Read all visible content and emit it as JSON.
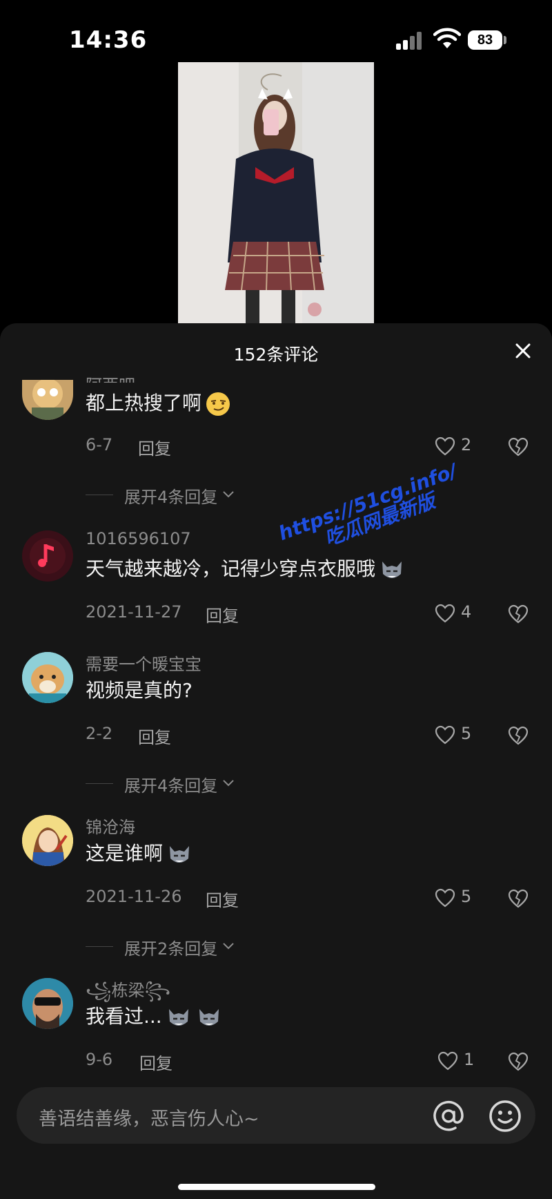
{
  "status": {
    "time": "14:36",
    "battery": "83"
  },
  "panel": {
    "title": "152条评论"
  },
  "comments": [
    {
      "name": "阿西吧",
      "text": "都上热搜了啊",
      "date": "6-7",
      "reply": "回复",
      "likes": "2",
      "expand": "展开4条回复"
    },
    {
      "name": "1016596107",
      "text": "天气越来越冷，记得少穿点衣服哦",
      "date": "2021-11-27",
      "reply": "回复",
      "likes": "4"
    },
    {
      "name": "需要一个暖宝宝",
      "text": "视频是真的?",
      "date": "2-2",
      "reply": "回复",
      "likes": "5",
      "expand": "展开4条回复"
    },
    {
      "name": "锦沧海",
      "text": "这是谁啊",
      "date": "2021-11-26",
      "reply": "回复",
      "likes": "5",
      "expand": "展开2条回复"
    },
    {
      "name": "꧁栋梁꧂",
      "text": "我看过...",
      "date": "9-6",
      "reply": "回复",
      "likes": "1"
    }
  ],
  "watermark": {
    "line1": "https://51cg.info/",
    "line2": "吃瓜网最新版"
  },
  "input": {
    "placeholder": "善语结善缘，恶言伤人心~"
  },
  "colors": {
    "panel": "#161616",
    "muted": "#8c8c8c",
    "watermark": "#1f4fe0"
  }
}
